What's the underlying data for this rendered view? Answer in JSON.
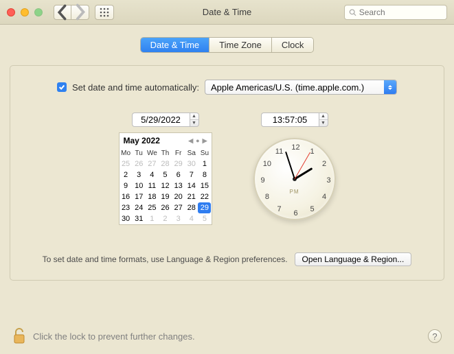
{
  "window": {
    "title": "Date & Time",
    "search_placeholder": "Search"
  },
  "tabs": {
    "a": "Date & Time",
    "b": "Time Zone",
    "c": "Clock"
  },
  "auto": {
    "label": "Set date and time automatically:",
    "server": "Apple Americas/U.S. (time.apple.com.)"
  },
  "date": {
    "value": "5/29/2022",
    "month_label": "May 2022",
    "dow": [
      "Mo",
      "Tu",
      "We",
      "Th",
      "Fr",
      "Sa",
      "Su"
    ],
    "cells": [
      {
        "d": "25",
        "o": 1
      },
      {
        "d": "26",
        "o": 1
      },
      {
        "d": "27",
        "o": 1
      },
      {
        "d": "28",
        "o": 1
      },
      {
        "d": "29",
        "o": 1
      },
      {
        "d": "30",
        "o": 1
      },
      {
        "d": "1"
      },
      {
        "d": "2"
      },
      {
        "d": "3"
      },
      {
        "d": "4"
      },
      {
        "d": "5"
      },
      {
        "d": "6"
      },
      {
        "d": "7"
      },
      {
        "d": "8"
      },
      {
        "d": "9"
      },
      {
        "d": "10"
      },
      {
        "d": "11"
      },
      {
        "d": "12"
      },
      {
        "d": "13"
      },
      {
        "d": "14"
      },
      {
        "d": "15"
      },
      {
        "d": "16"
      },
      {
        "d": "17"
      },
      {
        "d": "18"
      },
      {
        "d": "19"
      },
      {
        "d": "20"
      },
      {
        "d": "21"
      },
      {
        "d": "22"
      },
      {
        "d": "23"
      },
      {
        "d": "24"
      },
      {
        "d": "25"
      },
      {
        "d": "26"
      },
      {
        "d": "27"
      },
      {
        "d": "28"
      },
      {
        "d": "29",
        "s": 1
      },
      {
        "d": "30"
      },
      {
        "d": "31"
      },
      {
        "d": "1",
        "o": 1
      },
      {
        "d": "2",
        "o": 1
      },
      {
        "d": "3",
        "o": 1
      },
      {
        "d": "4",
        "o": 1
      },
      {
        "d": "5",
        "o": 1
      }
    ]
  },
  "time": {
    "value": "13:57:05",
    "ampm": "PM",
    "hour": 13,
    "minute": 57,
    "second": 5
  },
  "hint": "To set date and time formats, use Language & Region preferences.",
  "open_btn": "Open Language & Region...",
  "lock_text": "Click the lock to prevent further changes.",
  "clock_numbers": [
    "12",
    "1",
    "2",
    "3",
    "4",
    "5",
    "6",
    "7",
    "8",
    "9",
    "10",
    "11"
  ]
}
